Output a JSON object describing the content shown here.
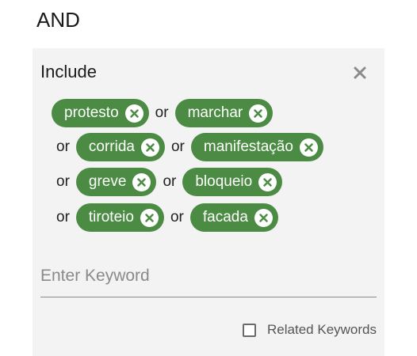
{
  "heading": "AND",
  "panel": {
    "title": "Include",
    "close_icon": "close-icon",
    "or_label": "or",
    "keywords": [
      "protesto",
      "marchar",
      "corrida",
      "manifestação",
      "greve",
      "bloqueio",
      "tiroteio",
      "facada"
    ],
    "input_placeholder": "Enter Keyword",
    "related_label": "Related Keywords",
    "related_checked": false
  },
  "colors": {
    "chip": "#4b8b43",
    "panel": "#f3f3f3"
  }
}
